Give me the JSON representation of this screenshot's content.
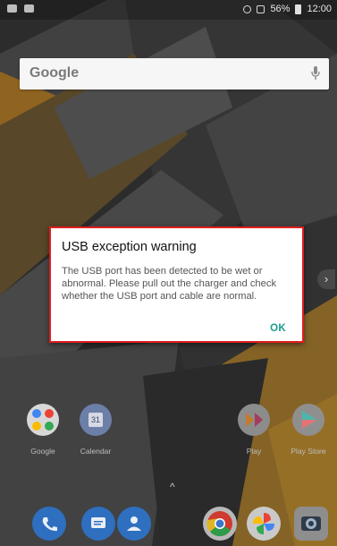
{
  "search": {
    "logo": "Google"
  },
  "dialog": {
    "title": "USB exception warning",
    "message": "The USB port has been detected to be wet or abnormal. Please pull out the charger and check whether the USB port and cable are normal.",
    "ok_label": "OK"
  },
  "status": {
    "battery": "56%",
    "time": "12:00"
  },
  "home": {
    "apps": [
      {
        "label": "Google"
      },
      {
        "label": "Calendar",
        "badge": "31"
      },
      {
        "label": "Play"
      },
      {
        "label": "Play Store"
      }
    ]
  },
  "dock": [
    "phone-icon",
    "messages-icon",
    "contacts-icon",
    "chrome-icon",
    "photos-icon",
    "camera-icon"
  ],
  "colors": {
    "dialog_border": "#e01e1e",
    "accent": "#1a9e8f"
  }
}
